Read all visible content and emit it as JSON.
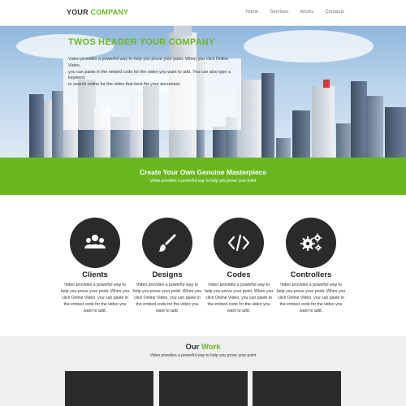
{
  "brand": {
    "part1": "YOUR",
    "part2": "COMPANY"
  },
  "nav": {
    "links": [
      "Home",
      "Services",
      "Works",
      "Contacts"
    ]
  },
  "hero": {
    "title": "TWOS HEADER YOUR COMPANY",
    "lines": [
      "Video provides a powerful way to help you prove your point. When you click Online Video,",
      "you can paste in the embed code for the video you want to add. You can also type a keyword",
      "to search online for the video that best fits your document."
    ]
  },
  "band": {
    "title": "Create Your Own Genuine Masterpiece",
    "subtitle": "Video provides a powerful way to help you prove your point"
  },
  "services": [
    {
      "title": "Clients",
      "icon": "users-icon",
      "lines": [
        "Video provides a powerful way to",
        "help you prove your point. When you",
        "click Online Video, you can paste in",
        "the embed code for the video you",
        "want to add."
      ]
    },
    {
      "title": "Designs",
      "icon": "paintbrush-icon",
      "lines": [
        "Video provides a powerful way to",
        "help you prove your point. When you",
        "click Online Video, you can paste in",
        "the embed code for the video you",
        "want to add."
      ]
    },
    {
      "title": "Codes",
      "icon": "code-icon",
      "lines": [
        "Video provides a powerful way to",
        "help you prove your point. When you",
        "click Online Video, you can paste in",
        "the embed code for the video you",
        "want to add."
      ]
    },
    {
      "title": "Controllers",
      "icon": "gears-icon",
      "lines": [
        "Video provides a powerful way to",
        "help you prove your point. When you",
        "click Online Video, you can paste in",
        "the embed code for the video you",
        "want to add."
      ]
    }
  ],
  "work": {
    "title_part1": "Our",
    "title_part2": "Work",
    "subtitle": "Video provides a powerful way to help you prove your point"
  },
  "colors": {
    "accent": "#6ab820",
    "dark": "#2a2a2a",
    "section_bg": "#efefef"
  }
}
